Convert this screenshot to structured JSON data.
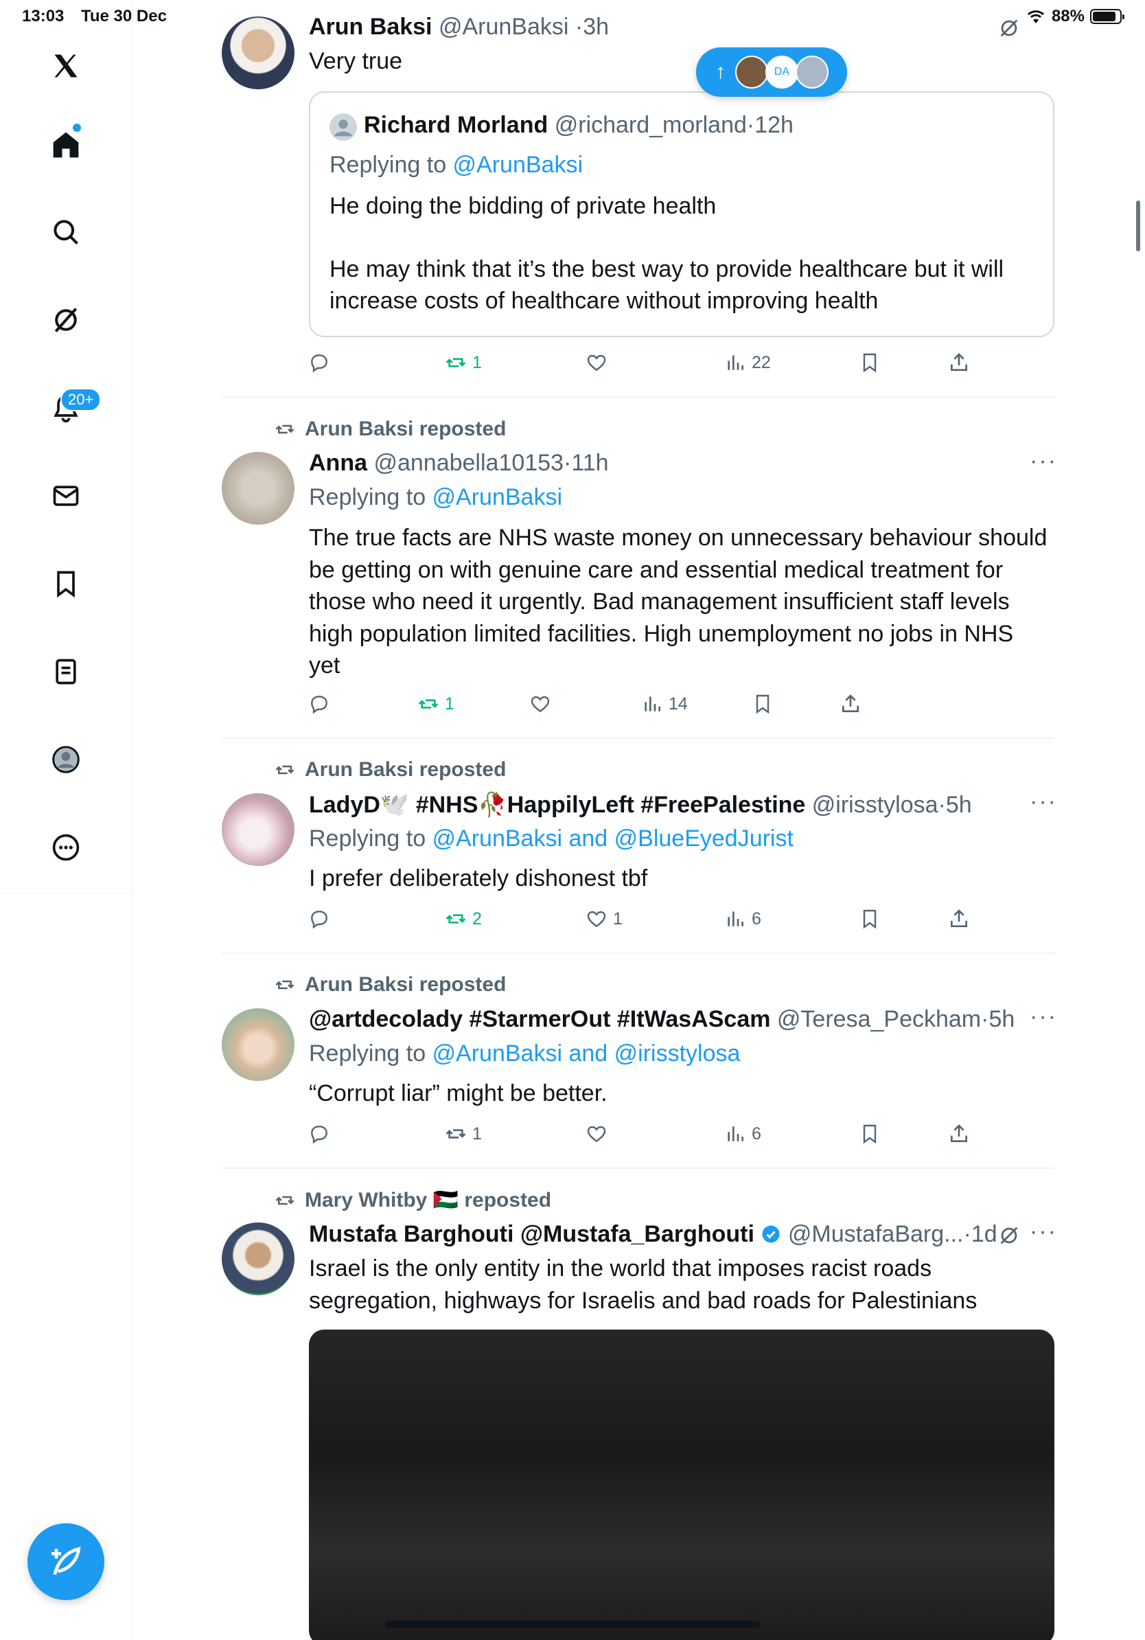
{
  "status": {
    "time": "13:03",
    "date": "Tue 30 Dec",
    "battery": "88%"
  },
  "sidebar": {
    "items": [
      {
        "name": "x-logo-icon"
      },
      {
        "name": "home-icon"
      },
      {
        "name": "search-icon"
      },
      {
        "name": "grok-icon"
      },
      {
        "name": "notifications-icon"
      },
      {
        "name": "messages-icon"
      },
      {
        "name": "bookmarks-icon"
      },
      {
        "name": "lists-icon"
      },
      {
        "name": "profile-icon"
      },
      {
        "name": "more-icon"
      }
    ],
    "notifications_badge": "20+"
  },
  "new_posts_pill": {
    "arrow": "↑",
    "avatar_text": "DA"
  },
  "posts": [
    {
      "name": "Arun Baksi",
      "handle": "@ArunBaksi",
      "time": "3h",
      "text": "Very true",
      "quote": {
        "name": "Richard Morland",
        "handle": "@richard_morland",
        "time": "12h",
        "replying_prefix": "Replying to ",
        "replying_to": "@ArunBaksi",
        "text1": "He doing the bidding of private health",
        "text2a": "He may think that it’s the best way to provide healthcare but it will",
        "text2b": "increase costs of healthcare without improving health"
      },
      "actions": {
        "retweets": "1",
        "views": "22"
      }
    },
    {
      "reposted_by": "Arun Baksi reposted",
      "name": "Anna",
      "handle": "@annabella10153",
      "time": "11h",
      "replying_prefix": "Replying to ",
      "replying_to": "@ArunBaksi",
      "lines": [
        "The true facts are NHS waste money on unnecessary behaviour should",
        "be getting on with genuine care and essential medical treatment for",
        "those who need it urgently. Bad management insufficient staff levels",
        "high population limited facilities. High unemployment no jobs in NHS",
        "yet"
      ],
      "actions": {
        "retweets": "1",
        "views": "14"
      }
    },
    {
      "reposted_by": "Arun Baksi reposted",
      "name": "LadyD🕊️ #NHS🥀HappilyLeft #FreePalestine",
      "handle": "@irisstylosa",
      "time": "5h",
      "replying_prefix": "Replying to ",
      "replying_to": "@ArunBaksi and @BlueEyedJurist",
      "text": "I prefer deliberately dishonest tbf",
      "actions": {
        "retweets": "2",
        "likes": "1",
        "views": "6"
      }
    },
    {
      "reposted_by": "Arun Baksi reposted",
      "name": "@artdecolady #StarmerOut #ItWasAScam",
      "handle": "@Teresa_Peckham",
      "time": "5h",
      "replying_prefix": "Replying to ",
      "replying_to": "@ArunBaksi and @irisstylosa",
      "text": "“Corrupt liar” might be better.",
      "actions": {
        "retweets": "1",
        "views": "6"
      }
    },
    {
      "reposted_by": "Mary Whitby 🇵🇸 reposted",
      "name": "Mustafa Barghouti @Mustafa_Barghouti",
      "handle": "@MustafaBarg...",
      "time": "1d",
      "lines": [
        "Israel  is the only entity in the world that imposes racist roads",
        "segregation, highways for Israelis and bad roads for Palestinians"
      ]
    }
  ],
  "colors": {
    "accent": "#1d9bf0",
    "muted": "#536471",
    "retweet": "#00ba7c",
    "divider": "#eff3f4"
  }
}
